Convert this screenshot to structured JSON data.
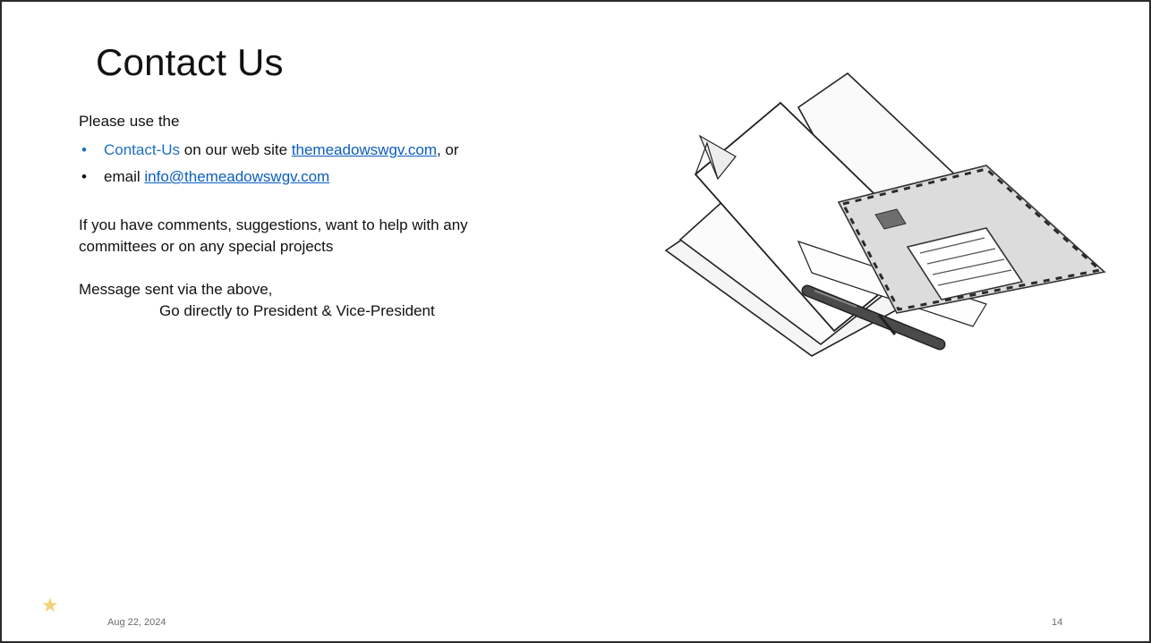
{
  "slide": {
    "title": "Contact Us",
    "intro": "Please use the",
    "bullets": [
      {
        "marker": "•",
        "lead": "Contact-Us",
        "text": " on our web site ",
        "link": "themeadowswgv.com",
        "tail": ", or"
      },
      {
        "marker": "•",
        "lead": "email ",
        "link": "info@themeadowswgv.com"
      }
    ],
    "paragraph1_line1": "If you have comments, suggestions, want to help with any",
    "paragraph1_line2": "committees or on any special projects",
    "paragraph2_line1": "Message sent via the above,",
    "paragraph2_line2": "Go directly to President & Vice-President"
  },
  "footer": {
    "date": "Aug 22, 2024",
    "page_number": "14",
    "star_icon": "★"
  },
  "colors": {
    "accent_blue": "#1f6fc0",
    "link_blue": "#0b5ebf",
    "star_gold": "#f0d277"
  },
  "illustration": {
    "icon": "envelope-papers-pen-icon"
  }
}
